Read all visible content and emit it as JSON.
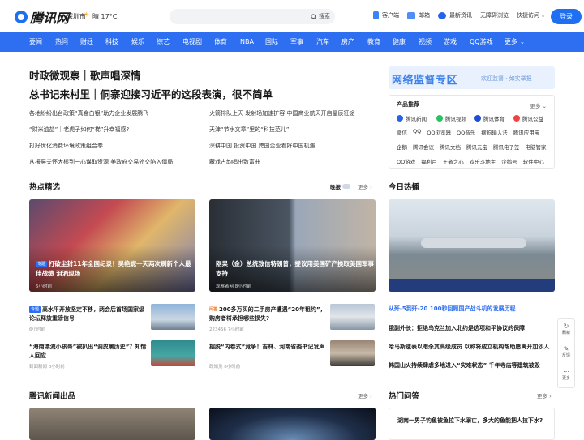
{
  "header": {
    "logo_text": "腾讯网",
    "city": "深圳市",
    "weather": "晴 17°C",
    "search_button": "搜索",
    "links": [
      "客户端",
      "邮箱",
      "最新资讯",
      "无障碍浏览",
      "快捷访问"
    ],
    "login": "登录"
  },
  "nav": [
    "要闻",
    "热问",
    "财经",
    "科技",
    "娱乐",
    "综艺",
    "电视剧",
    "体育",
    "NBA",
    "国际",
    "军事",
    "汽车",
    "房产",
    "教育",
    "健康",
    "视频",
    "游戏",
    "QQ游戏",
    "更多"
  ],
  "top_news": {
    "headline1": "时政微观察｜歌声唱深情",
    "headline2": "总书记来村里｜侗寨迎接习近平的这段表演，很不简单",
    "left": [
      "各地纷纷出台政策“真金白银”助力企业发展腾飞",
      "“财米油盐”｜老虎子如何“梯”升幸福感?",
      "打好优化消费环境政策组合拳",
      "从报屏关怀大棒到一心谋取资源 美政府交易外交陷入僵局"
    ],
    "right": [
      "火箭排队上天 发射场加速扩容 中国商业航天开启星辰征途",
      "天津“节水文章”里的“科技范儿”",
      "深耕中国 投资中国 跨国企业看好中国机遇",
      "藏戏古韵唱出致富曲"
    ]
  },
  "sidebar": {
    "banner_title": "网络监督专区",
    "banner_sub": "欢迎监督 · 如实举报",
    "products_title": "产品推荐",
    "products_more": "更多",
    "apps": [
      "腾讯新闻",
      "腾讯视频",
      "腾讯体育",
      "腾讯公益"
    ],
    "row1": [
      "微信",
      "QQ",
      "QQ浏览器",
      "QQ音乐",
      "搜狗输入法",
      "腾讯应用宝"
    ],
    "row2": [
      "企鹅",
      "腾讯会议",
      "腾讯文档",
      "腾讯元宝",
      "腾讯电子签",
      "电脑管家"
    ],
    "row3": [
      "QQ游戏",
      "福利月",
      "王者之心",
      "欢乐斗地主",
      "企鹅号",
      "软件中心"
    ]
  },
  "hot": {
    "title": "热点精选",
    "toggle": "晚报",
    "more": "更多",
    "card1": {
      "tag": "专题",
      "title": "打破尘封11年全国纪录！吴艳妮一天两次刷新个人最佳战绩 泪洒现场",
      "meta": "5小时前"
    },
    "card2": {
      "title": "刚果（金）总统致信特朗普，提议用美国矿产换取美国军事支持",
      "meta": "观察者网 8小时前"
    },
    "items": [
      {
        "tag": "专题",
        "title": "高水平开放坚定不移，两会后首场国家级论坛释放重磅信号",
        "meta": "6小时前"
      },
      {
        "tag": "问答",
        "title": "200多万买的二手房产遭遇“20年租约”，购房者将承担哪些损失?",
        "meta": "223456 7小时前"
      },
      {
        "tag": "",
        "title": "“海南漂流小孩哥”被扒出“调皮黑历史”？知情人回应",
        "meta": "封面新闻 8小时前"
      },
      {
        "tag": "",
        "title": "摆脱“内卷式”竞争！吉林、河南省委书记发声",
        "meta": "政知见 8小时前"
      }
    ]
  },
  "today": {
    "title": "今日热播",
    "lines": [
      "从歼-5到歼-20 100秒回顾国产战斗机的发展历程",
      "俄副外长：拒绝乌克兰加入北约是选项和平协议的保障",
      "哈马斯逮表以暗杀其高级成员 以称将成立机构帮助愿离开加沙人",
      "韩国山火持续肆虐多地进入“灾难状态” 千年寺庙等建筑被毁"
    ]
  },
  "bottom": {
    "news_title": "腾讯新闻出品",
    "news_more": "更多",
    "qa_title": "热门问答",
    "qa_more": "更多",
    "qa_text": "湖南一男子钓鱼被鱼拉下水溺亡，多大的鱼能把人拉下水?"
  },
  "tools": [
    "刷新",
    "反馈",
    "更多"
  ],
  "colors": {
    "brand": "#2d6ff0",
    "banner_bg": "#e8f1fd",
    "accent_orange": "#f56b1d"
  }
}
